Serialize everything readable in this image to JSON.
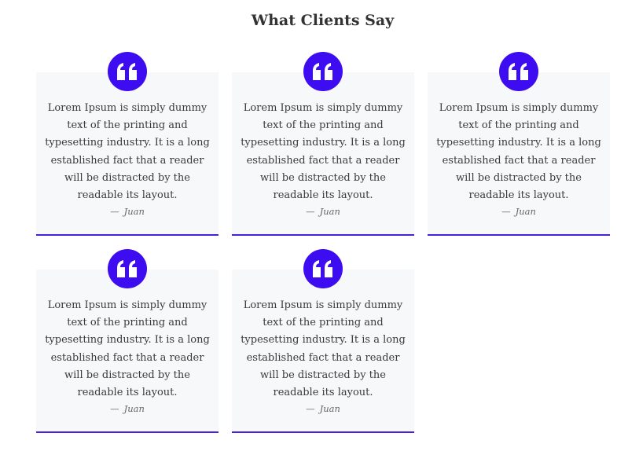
{
  "section": {
    "title": "What Clients Say"
  },
  "accent_color": "#3d0cf0",
  "testimonials": [
    {
      "icon": "quote-icon",
      "text": "Lorem Ipsum is simply dummy text of the printing and typesetting industry. It is a long established fact that a reader will be distracted by the readable its layout.",
      "dash": "—",
      "author": "Juan"
    },
    {
      "icon": "quote-icon",
      "text": "Lorem Ipsum is simply dummy text of the printing and typesetting industry. It is a long established fact that a reader will be distracted by the readable its layout.",
      "dash": "—",
      "author": "Juan"
    },
    {
      "icon": "quote-icon",
      "text": "Lorem Ipsum is simply dummy text of the printing and typesetting industry. It is a long established fact that a reader will be distracted by the readable its layout.",
      "dash": "—",
      "author": "Juan"
    },
    {
      "icon": "quote-icon",
      "text": "Lorem Ipsum is simply dummy text of the printing and typesetting industry. It is a long established fact that a reader will be distracted by the readable its layout.",
      "dash": "—",
      "author": "Juan"
    },
    {
      "icon": "quote-icon",
      "text": "Lorem Ipsum is simply dummy text of the printing and typesetting industry. It is a long established fact that a reader will be distracted by the readable its layout.",
      "dash": "—",
      "author": "Juan"
    }
  ]
}
